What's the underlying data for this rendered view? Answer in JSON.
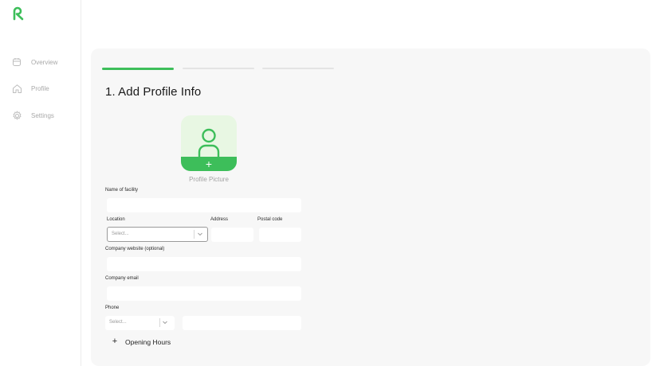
{
  "colors": {
    "accent": "#3dbe5a",
    "accent_light": "#e8f7e3",
    "panel_bg": "#f7f7f7",
    "muted_text": "#a9a9a9"
  },
  "sidebar": {
    "logo_icon": "brand-logo-icon",
    "items": [
      {
        "label": "Overview",
        "icon": "calendar-icon"
      },
      {
        "label": "Profile",
        "icon": "home-icon"
      },
      {
        "label": "Settings",
        "icon": "gear-icon"
      }
    ]
  },
  "stepper": {
    "total_steps": 3,
    "current_step": 1
  },
  "form": {
    "heading": "1. Add Profile Info",
    "profile_picture": {
      "caption": "Profile Picture",
      "icon": "user-add-icon"
    },
    "facility_name": {
      "label": "Name of facility",
      "value": ""
    },
    "location": {
      "label": "Location",
      "placeholder": "Select..."
    },
    "address": {
      "label": "Address",
      "value": ""
    },
    "postal_code": {
      "label": "Postal code",
      "value": ""
    },
    "website": {
      "label": "Company website (optional)",
      "value": ""
    },
    "email": {
      "label": "Company email",
      "value": ""
    },
    "phone": {
      "label": "Phone",
      "code_placeholder": "Select...",
      "value": ""
    },
    "opening_hours": {
      "label": "Opening Hours",
      "icon": "plus-icon"
    }
  }
}
